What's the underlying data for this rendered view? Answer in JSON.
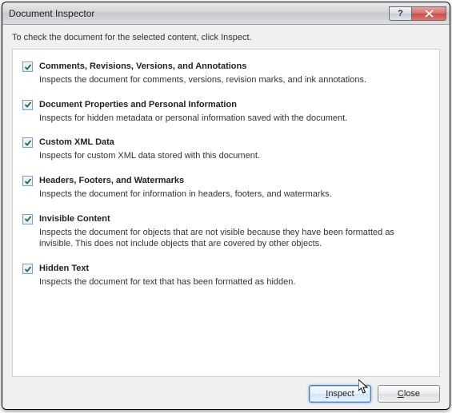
{
  "window": {
    "title": "Document Inspector",
    "help_button": "?",
    "close_button": "✕"
  },
  "instruction": "To check the document for the selected content, click Inspect.",
  "items": [
    {
      "checked": true,
      "title": "Comments, Revisions, Versions, and Annotations",
      "desc": "Inspects the document for comments, versions, revision marks, and ink annotations."
    },
    {
      "checked": true,
      "title": "Document Properties and Personal Information",
      "desc": "Inspects for hidden metadata or personal information saved with the document."
    },
    {
      "checked": true,
      "title": "Custom XML Data",
      "desc": "Inspects for custom XML data stored with this document."
    },
    {
      "checked": true,
      "title": "Headers, Footers, and Watermarks",
      "desc": "Inspects the document for information in headers, footers, and watermarks."
    },
    {
      "checked": true,
      "title": "Invisible Content",
      "desc": "Inspects the document for objects that are not visible because they have been formatted as invisible. This does not include objects that are covered by other objects."
    },
    {
      "checked": true,
      "title": "Hidden Text",
      "desc": "Inspects the document for text that has been formatted as hidden."
    }
  ],
  "footer": {
    "inspect_prefix": "",
    "inspect_underline": "I",
    "inspect_suffix": "nspect",
    "close_prefix": "",
    "close_underline": "C",
    "close_suffix": "lose"
  }
}
